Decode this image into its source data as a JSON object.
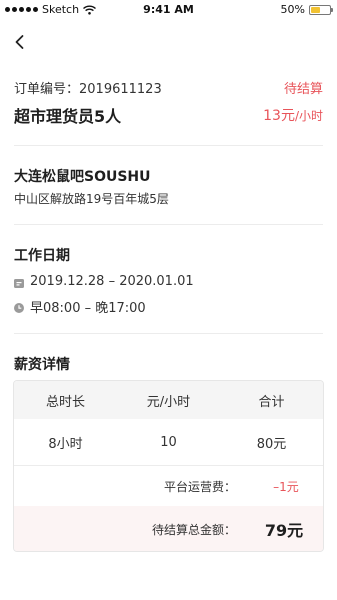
{
  "status_bar": {
    "carrier": "Sketch",
    "time": "9:41 AM",
    "battery": "50%",
    "battery_level": 0.5
  },
  "order": {
    "number_label": "订单编号：2019611123",
    "status": "待结算",
    "job_title": "超市理货员5人",
    "wage": "13元",
    "wage_unit": "/小时"
  },
  "company": {
    "name": "大连松鼠吧SOUSHU",
    "address": "中山区解放路19号百年城5层"
  },
  "work": {
    "title": "工作日期",
    "date_range": "2019.12.28 – 2020.01.01",
    "time_range": "早08:00 – 晚17:00"
  },
  "salary": {
    "title": "薪资详情",
    "headers": [
      "总时长",
      "元/小时",
      "合计"
    ],
    "row": [
      "8小时",
      "10",
      "80元"
    ],
    "fee_label": "平台运营费：",
    "fee_value": "–1元",
    "total_label": "待结算总金额：",
    "total_value": "79元"
  },
  "colors": {
    "accent": "#e8545a",
    "text": "#333333",
    "divider": "#ececec"
  },
  "icons": {
    "back": "chevron-left-icon",
    "date": "calendar-icon",
    "time": "clock-icon"
  }
}
